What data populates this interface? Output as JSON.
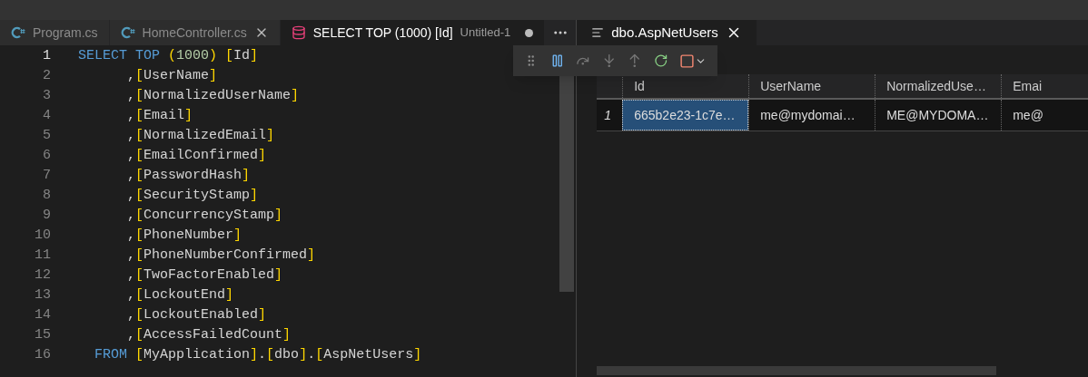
{
  "editor_tabs": [
    {
      "kind": "csharp",
      "label": "Program.cs",
      "selected": false,
      "closable": false,
      "dirty": false
    },
    {
      "kind": "csharp",
      "label": "HomeController.cs",
      "selected": false,
      "closable": true,
      "dirty": false
    },
    {
      "kind": "sql",
      "label": "SELECT TOP (1000) [Id]",
      "description": "Untitled-1",
      "selected": true,
      "closable": false,
      "dirty": true
    }
  ],
  "code_lines": [
    {
      "number": "1",
      "kind": "first",
      "current": true,
      "tokens": [
        {
          "kind": "keyword",
          "text": "SELECT TOP "
        },
        {
          "kind": "bracket",
          "text": "("
        },
        {
          "kind": "number",
          "text": "1000"
        },
        {
          "kind": "bracket",
          "text": ") ["
        },
        {
          "kind": "plain",
          "text": "Id"
        },
        {
          "kind": "bracket",
          "text": "]"
        }
      ]
    },
    {
      "number": "2",
      "kind": "column",
      "current": false,
      "tokens": [
        {
          "kind": "plain",
          "text": ","
        },
        {
          "kind": "bracket",
          "text": "["
        },
        {
          "kind": "plain",
          "text": "UserName"
        },
        {
          "kind": "bracket",
          "text": "]"
        }
      ]
    },
    {
      "number": "3",
      "kind": "column",
      "current": false,
      "tokens": [
        {
          "kind": "plain",
          "text": ","
        },
        {
          "kind": "bracket",
          "text": "["
        },
        {
          "kind": "plain",
          "text": "NormalizedUserName"
        },
        {
          "kind": "bracket",
          "text": "]"
        }
      ]
    },
    {
      "number": "4",
      "kind": "column",
      "current": false,
      "tokens": [
        {
          "kind": "plain",
          "text": ","
        },
        {
          "kind": "bracket",
          "text": "["
        },
        {
          "kind": "plain",
          "text": "Email"
        },
        {
          "kind": "bracket",
          "text": "]"
        }
      ]
    },
    {
      "number": "5",
      "kind": "column",
      "current": false,
      "tokens": [
        {
          "kind": "plain",
          "text": ","
        },
        {
          "kind": "bracket",
          "text": "["
        },
        {
          "kind": "plain",
          "text": "NormalizedEmail"
        },
        {
          "kind": "bracket",
          "text": "]"
        }
      ]
    },
    {
      "number": "6",
      "kind": "column",
      "current": false,
      "tokens": [
        {
          "kind": "plain",
          "text": ","
        },
        {
          "kind": "bracket",
          "text": "["
        },
        {
          "kind": "plain",
          "text": "EmailConfirmed"
        },
        {
          "kind": "bracket",
          "text": "]"
        }
      ]
    },
    {
      "number": "7",
      "kind": "column",
      "current": false,
      "tokens": [
        {
          "kind": "plain",
          "text": ","
        },
        {
          "kind": "bracket",
          "text": "["
        },
        {
          "kind": "plain",
          "text": "PasswordHash"
        },
        {
          "kind": "bracket",
          "text": "]"
        }
      ]
    },
    {
      "number": "8",
      "kind": "column",
      "current": false,
      "tokens": [
        {
          "kind": "plain",
          "text": ","
        },
        {
          "kind": "bracket",
          "text": "["
        },
        {
          "kind": "plain",
          "text": "SecurityStamp"
        },
        {
          "kind": "bracket",
          "text": "]"
        }
      ]
    },
    {
      "number": "9",
      "kind": "column",
      "current": false,
      "tokens": [
        {
          "kind": "plain",
          "text": ","
        },
        {
          "kind": "bracket",
          "text": "["
        },
        {
          "kind": "plain",
          "text": "ConcurrencyStamp"
        },
        {
          "kind": "bracket",
          "text": "]"
        }
      ]
    },
    {
      "number": "10",
      "kind": "column",
      "current": false,
      "tokens": [
        {
          "kind": "plain",
          "text": ","
        },
        {
          "kind": "bracket",
          "text": "["
        },
        {
          "kind": "plain",
          "text": "PhoneNumber"
        },
        {
          "kind": "bracket",
          "text": "]"
        }
      ]
    },
    {
      "number": "11",
      "kind": "column",
      "current": false,
      "tokens": [
        {
          "kind": "plain",
          "text": ","
        },
        {
          "kind": "bracket",
          "text": "["
        },
        {
          "kind": "plain",
          "text": "PhoneNumberConfirmed"
        },
        {
          "kind": "bracket",
          "text": "]"
        }
      ]
    },
    {
      "number": "12",
      "kind": "column",
      "current": false,
      "tokens": [
        {
          "kind": "plain",
          "text": ","
        },
        {
          "kind": "bracket",
          "text": "["
        },
        {
          "kind": "plain",
          "text": "TwoFactorEnabled"
        },
        {
          "kind": "bracket",
          "text": "]"
        }
      ]
    },
    {
      "number": "13",
      "kind": "column",
      "current": false,
      "tokens": [
        {
          "kind": "plain",
          "text": ","
        },
        {
          "kind": "bracket",
          "text": "["
        },
        {
          "kind": "plain",
          "text": "LockoutEnd"
        },
        {
          "kind": "bracket",
          "text": "]"
        }
      ]
    },
    {
      "number": "14",
      "kind": "column",
      "current": false,
      "tokens": [
        {
          "kind": "plain",
          "text": ","
        },
        {
          "kind": "bracket",
          "text": "["
        },
        {
          "kind": "plain",
          "text": "LockoutEnabled"
        },
        {
          "kind": "bracket",
          "text": "]"
        }
      ]
    },
    {
      "number": "15",
      "kind": "column",
      "current": false,
      "tokens": [
        {
          "kind": "plain",
          "text": ","
        },
        {
          "kind": "bracket",
          "text": "["
        },
        {
          "kind": "plain",
          "text": "AccessFailedCount"
        },
        {
          "kind": "bracket",
          "text": "]"
        }
      ]
    },
    {
      "number": "16",
      "kind": "from",
      "current": false,
      "tokens": [
        {
          "kind": "keyword",
          "text": "FROM "
        },
        {
          "kind": "bracket",
          "text": "["
        },
        {
          "kind": "plain",
          "text": "MyApplication"
        },
        {
          "kind": "bracket",
          "text": "]"
        },
        {
          "kind": "plain",
          "text": "."
        },
        {
          "kind": "bracket",
          "text": "["
        },
        {
          "kind": "plain",
          "text": "dbo"
        },
        {
          "kind": "bracket",
          "text": "]"
        },
        {
          "kind": "plain",
          "text": "."
        },
        {
          "kind": "bracket",
          "text": "["
        },
        {
          "kind": "plain",
          "text": "AspNetUsers"
        },
        {
          "kind": "bracket",
          "text": "]"
        }
      ]
    }
  ],
  "results_tab": {
    "label": "dbo.AspNetUsers",
    "selected": true
  },
  "grid": {
    "columns": [
      "Id",
      "UserName",
      "NormalizedUse…",
      "Emai"
    ],
    "rows": [
      {
        "number": "1",
        "cells": [
          {
            "text": "665b2e23-1c7e…",
            "selected": true
          },
          {
            "text": "me@mydomai…",
            "selected": false
          },
          {
            "text": "ME@MYDOMA…",
            "selected": false
          },
          {
            "text": "me@",
            "selected": false
          }
        ]
      }
    ]
  }
}
